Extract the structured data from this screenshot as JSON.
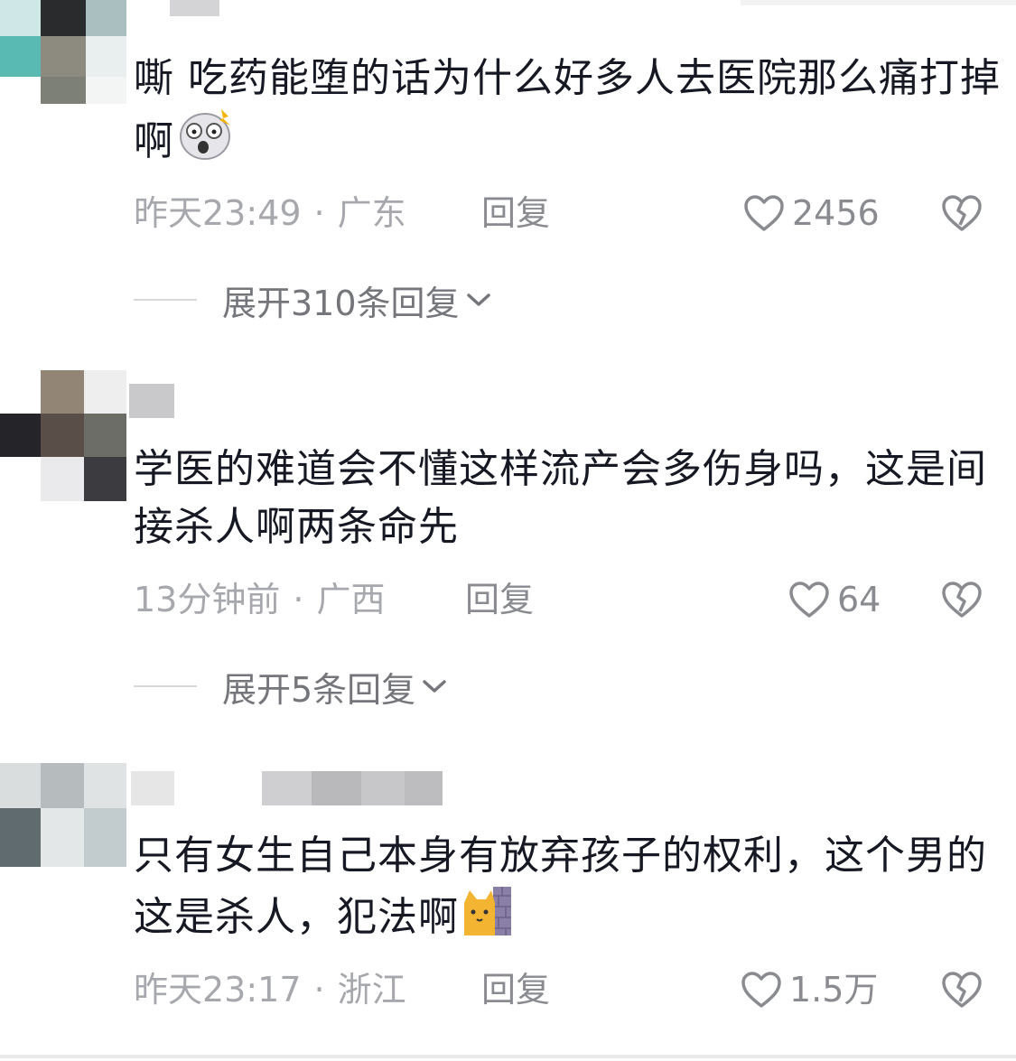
{
  "comments": [
    {
      "text": "嘶 吃药能堕的话为什么好多人去医院那么痛打掉啊",
      "emoji": "shocked-face-emoji",
      "time": "昨天23:49",
      "dot": "·",
      "region": "广东",
      "reply_label": "回复",
      "likes": "2456",
      "expand_label": "展开310条回复"
    },
    {
      "text": "学医的难道会不懂这样流产会多伤身吗，这是间接杀人啊两条命先",
      "time": "13分钟前",
      "dot": "·",
      "region": "广西",
      "reply_label": "回复",
      "likes": "64",
      "expand_label": "展开5条回复"
    },
    {
      "text": "只有女生自己本身有放弃孩子的权利，这个男的这是杀人，犯法啊",
      "emoji": "cat-behind-wall-emoji",
      "time": "昨天23:17",
      "dot": "·",
      "region": "浙江",
      "reply_label": "回复",
      "likes": "1.5万"
    }
  ],
  "colors": {
    "text": "#161823",
    "meta": "#a7a8ad",
    "action": "#8a8b90"
  }
}
